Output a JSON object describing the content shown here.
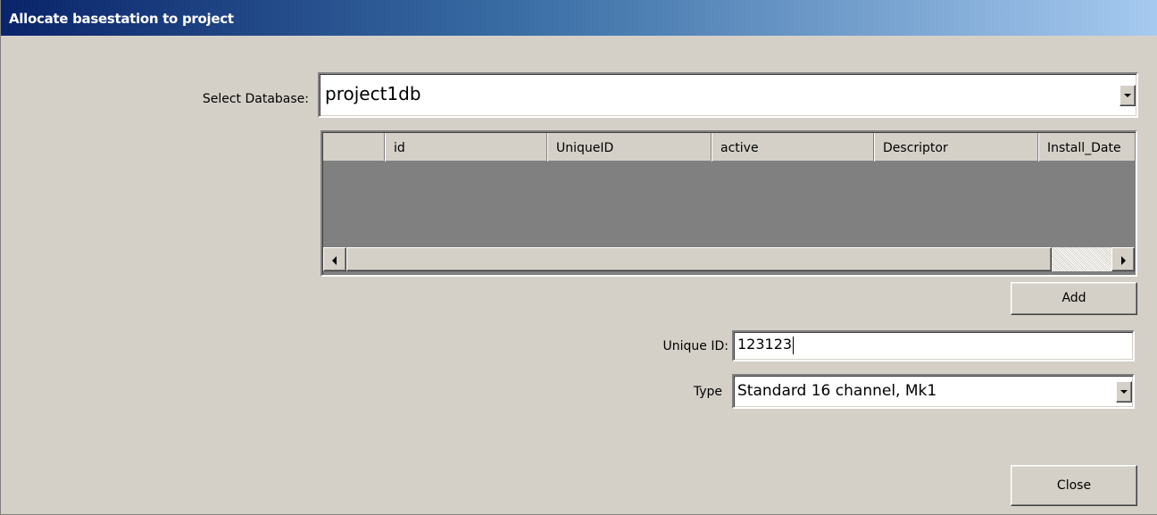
{
  "window": {
    "title": "Allocate basestation to project"
  },
  "database": {
    "label": "Select Database:",
    "value": "project1db"
  },
  "grid": {
    "columns": [
      "",
      "id",
      "UniqueID",
      "active",
      "Descriptor",
      "Install_Date"
    ],
    "rows": []
  },
  "actions": {
    "add_label": "Add",
    "close_label": "Close"
  },
  "unique_id": {
    "label": "Unique ID:",
    "value": "123123"
  },
  "type": {
    "label": "Type",
    "value": "Standard 16 channel, Mk1"
  },
  "icons": {
    "dropdown": "chevron-down-icon",
    "scroll_left": "arrow-left-icon",
    "scroll_right": "arrow-right-icon"
  }
}
